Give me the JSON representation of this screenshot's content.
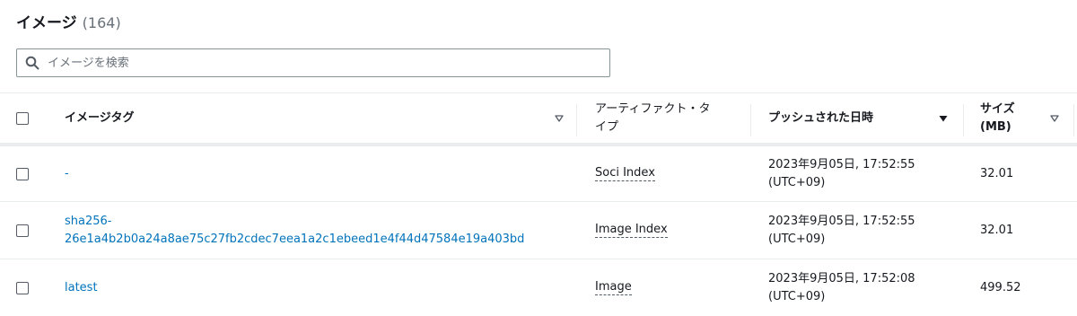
{
  "header": {
    "title": "イメージ",
    "count": "(164)"
  },
  "search": {
    "placeholder": "イメージを検索"
  },
  "columns": {
    "tag": "イメージタグ",
    "type_line1": "アーティファクト・タ",
    "type_line2": "イプ",
    "pushed": "プッシュされた日時",
    "size_line1": "サイズ",
    "size_line2": "(MB)"
  },
  "rows": [
    {
      "tag_line1": "-",
      "tag_line2": "",
      "type": "Soci Index",
      "date_line1": "2023年9月05日, 17:52:55",
      "date_line2": "(UTC+09)",
      "size": "32.01"
    },
    {
      "tag_line1": "sha256-",
      "tag_line2": "26e1a4b2b0a24a8ae75c27fb2cdec7eea1a2c1ebeed1e4f44d47584e19a403bd",
      "type": "Image Index",
      "date_line1": "2023年9月05日, 17:52:55",
      "date_line2": "(UTC+09)",
      "size": "32.01"
    },
    {
      "tag_line1": "latest",
      "tag_line2": "",
      "type": "Image",
      "date_line1": "2023年9月05日, 17:52:08",
      "date_line2": "(UTC+09)",
      "size": "499.52"
    }
  ]
}
